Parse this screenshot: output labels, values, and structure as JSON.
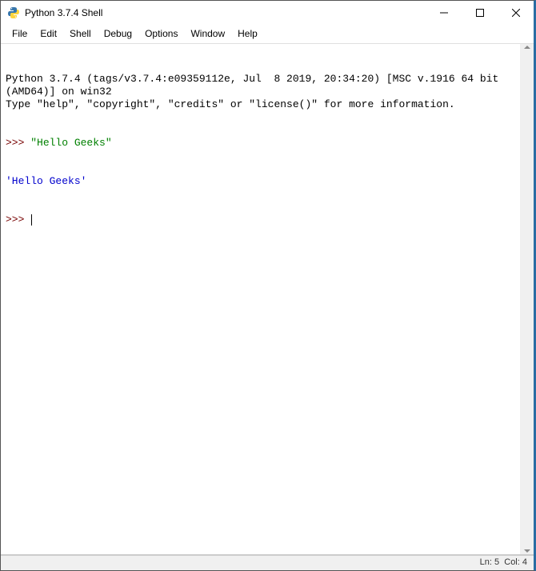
{
  "window": {
    "title": "Python 3.7.4 Shell"
  },
  "menu": {
    "items": [
      "File",
      "Edit",
      "Shell",
      "Debug",
      "Options",
      "Window",
      "Help"
    ]
  },
  "console": {
    "banner": "Python 3.7.4 (tags/v3.7.4:e09359112e, Jul  8 2019, 20:34:20) [MSC v.1916 64 bit (AMD64)] on win32\nType \"help\", \"copyright\", \"credits\" or \"license()\" for more information.",
    "prompt": ">>> ",
    "entries": [
      {
        "input": "\"Hello Geeks\"",
        "output": "'Hello Geeks'"
      }
    ]
  },
  "status": {
    "ln_label": "Ln:",
    "ln_value": "5",
    "col_label": "Col:",
    "col_value": "4"
  }
}
